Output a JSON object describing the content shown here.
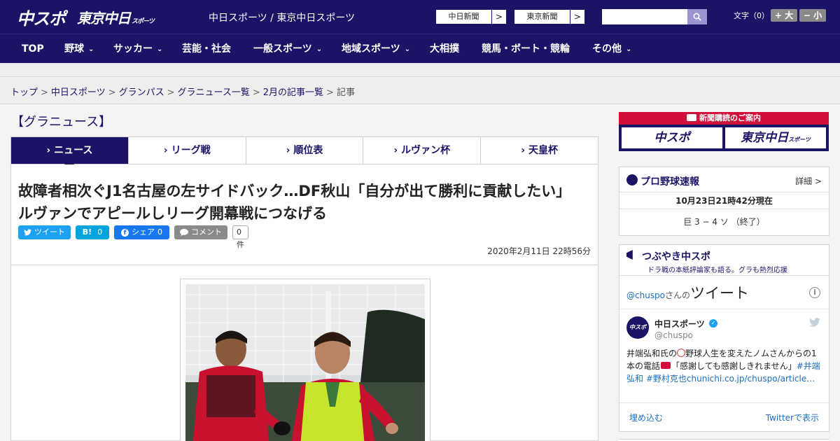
{
  "header": {
    "logo_chuspo": "中スポ",
    "logo_tokyo": "東京中日",
    "logo_tokyo_small": "スポーツ",
    "site_links": "中日スポーツ / 東京中日スポーツ",
    "ext_links": [
      {
        "label": "中日新聞",
        "arrow": ">"
      },
      {
        "label": "東京新聞",
        "arrow": ">"
      }
    ],
    "search_placeholder": "",
    "font_size_label": "文字（0）",
    "font_bigger": "+ 大",
    "font_smaller": "− 小"
  },
  "nav": [
    {
      "label": "TOP",
      "dropdown": false
    },
    {
      "label": "野球",
      "dropdown": true
    },
    {
      "label": "サッカー",
      "dropdown": true
    },
    {
      "label": "芸能・社会",
      "dropdown": false
    },
    {
      "label": "一般スポーツ",
      "dropdown": true
    },
    {
      "label": "地域スポーツ",
      "dropdown": true
    },
    {
      "label": "大相撲",
      "dropdown": false
    },
    {
      "label": "競馬・ボート・競輪",
      "dropdown": false
    },
    {
      "label": "その他",
      "dropdown": true
    }
  ],
  "breadcrumb": {
    "items": [
      "トップ",
      "中日スポーツ",
      "グランパス",
      "グラニュース一覧",
      "2月の記事一覧"
    ],
    "current": "記事",
    "separator": ">"
  },
  "section_title": "【グラニュース】",
  "tabs": [
    {
      "label": "ニュース",
      "active": true
    },
    {
      "label": "リーグ戦",
      "active": false
    },
    {
      "label": "順位表",
      "active": false
    },
    {
      "label": "ルヴァン杯",
      "active": false
    },
    {
      "label": "天皇杯",
      "active": false
    }
  ],
  "article": {
    "headline": "故障者相次ぐJ1名古屋の左サイドバック…DF秋山「自分が出て勝利に貢献したい」ルヴァンでアピールしリーグ開幕戦につなげる",
    "share": {
      "tweet": "ツイート",
      "hatena": "B!",
      "hatena_count": "0",
      "fb_share": "シェア",
      "fb_count": "0",
      "comment": "コメント",
      "comment_count": "0件"
    },
    "date": "2020年2月11日 22時56分"
  },
  "sidebar": {
    "subscribe_title": "新聞購読のご案内",
    "subscribe_chuspo": "中スポ",
    "subscribe_tokyo": "東京中日",
    "subscribe_tokyo_small": "スポーツ",
    "baseball": {
      "title": "プロ野球速報",
      "detail": "詳細 >",
      "timestamp": "10月23日21時42分現在",
      "score": "巨 3 − 4 ソ （終了）"
    },
    "tsubuyaki": {
      "title": "つぶやき中スポ",
      "subtitle": "ドラ戦の本紙評論家も語る。グラも熱烈応援",
      "handle_prefix": "@chuspo",
      "handle_suffix": "さんの",
      "tweet_word": "ツイート",
      "account_name": "中日スポーツ",
      "account_handle": "@chuspo",
      "avatar_text": "中スポ",
      "tweet_text_1": "井端弘和氏の",
      "tweet_text_2": "野球人生を変えたノムさんからの1本の電話",
      "tweet_text_3": "「感謝しても感謝しきれません」",
      "hashtag_1": "#井端弘和",
      "hashtag_2": "#野村克也",
      "link": "chunichi.co.jp/chuspo/article…",
      "embed": "埋め込む",
      "view_on_twitter": "Twitterで表示"
    }
  },
  "colors": {
    "brand_navy": "#1a1366",
    "accent_red": "#d0103a",
    "twitter_blue": "#1da1f2",
    "hatena_blue": "#00a4de",
    "facebook_blue": "#1877f2",
    "comment_gray": "#8a8a8a"
  }
}
